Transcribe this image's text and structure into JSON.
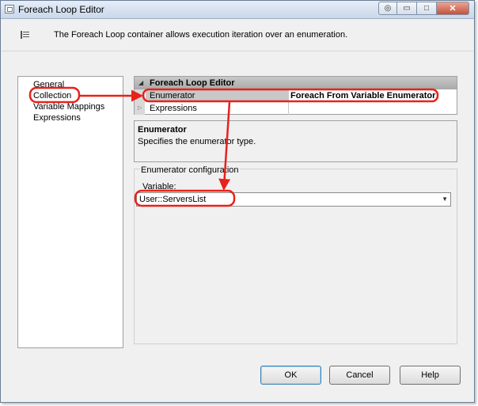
{
  "window": {
    "title": "Foreach Loop Editor",
    "buttons": {
      "help": "◎",
      "minimize": "▭",
      "maximize": "□",
      "close": "✕"
    }
  },
  "header": {
    "description": "The Foreach Loop container allows execution iteration over an enumeration."
  },
  "nav": {
    "items": [
      {
        "label": "General"
      },
      {
        "label": "Collection"
      },
      {
        "label": "Variable Mappings"
      },
      {
        "label": "Expressions"
      }
    ]
  },
  "grid": {
    "header": "Foreach Loop Editor",
    "rows": [
      {
        "name": "Enumerator",
        "value": "Foreach From Variable Enumerator"
      },
      {
        "name": "Expressions",
        "value": ""
      }
    ]
  },
  "description_box": {
    "title": "Enumerator",
    "text": "Specifies the enumerator type."
  },
  "config": {
    "title": "Enumerator configuration",
    "variable_label": "Variable:",
    "variable_value": "User::ServersList"
  },
  "footer": {
    "ok": "OK",
    "cancel": "Cancel",
    "help": "Help"
  },
  "colors": {
    "annotation": "#e8211b",
    "grid_header": "#b5b5b5",
    "selected_row": "#c8c8c8"
  },
  "icons": {
    "window": "window-icon",
    "header": "properties-icon",
    "collapse": "collapse-triangle-icon",
    "expand": "expand-triangle-icon",
    "dropdown": "chevron-down-icon"
  }
}
